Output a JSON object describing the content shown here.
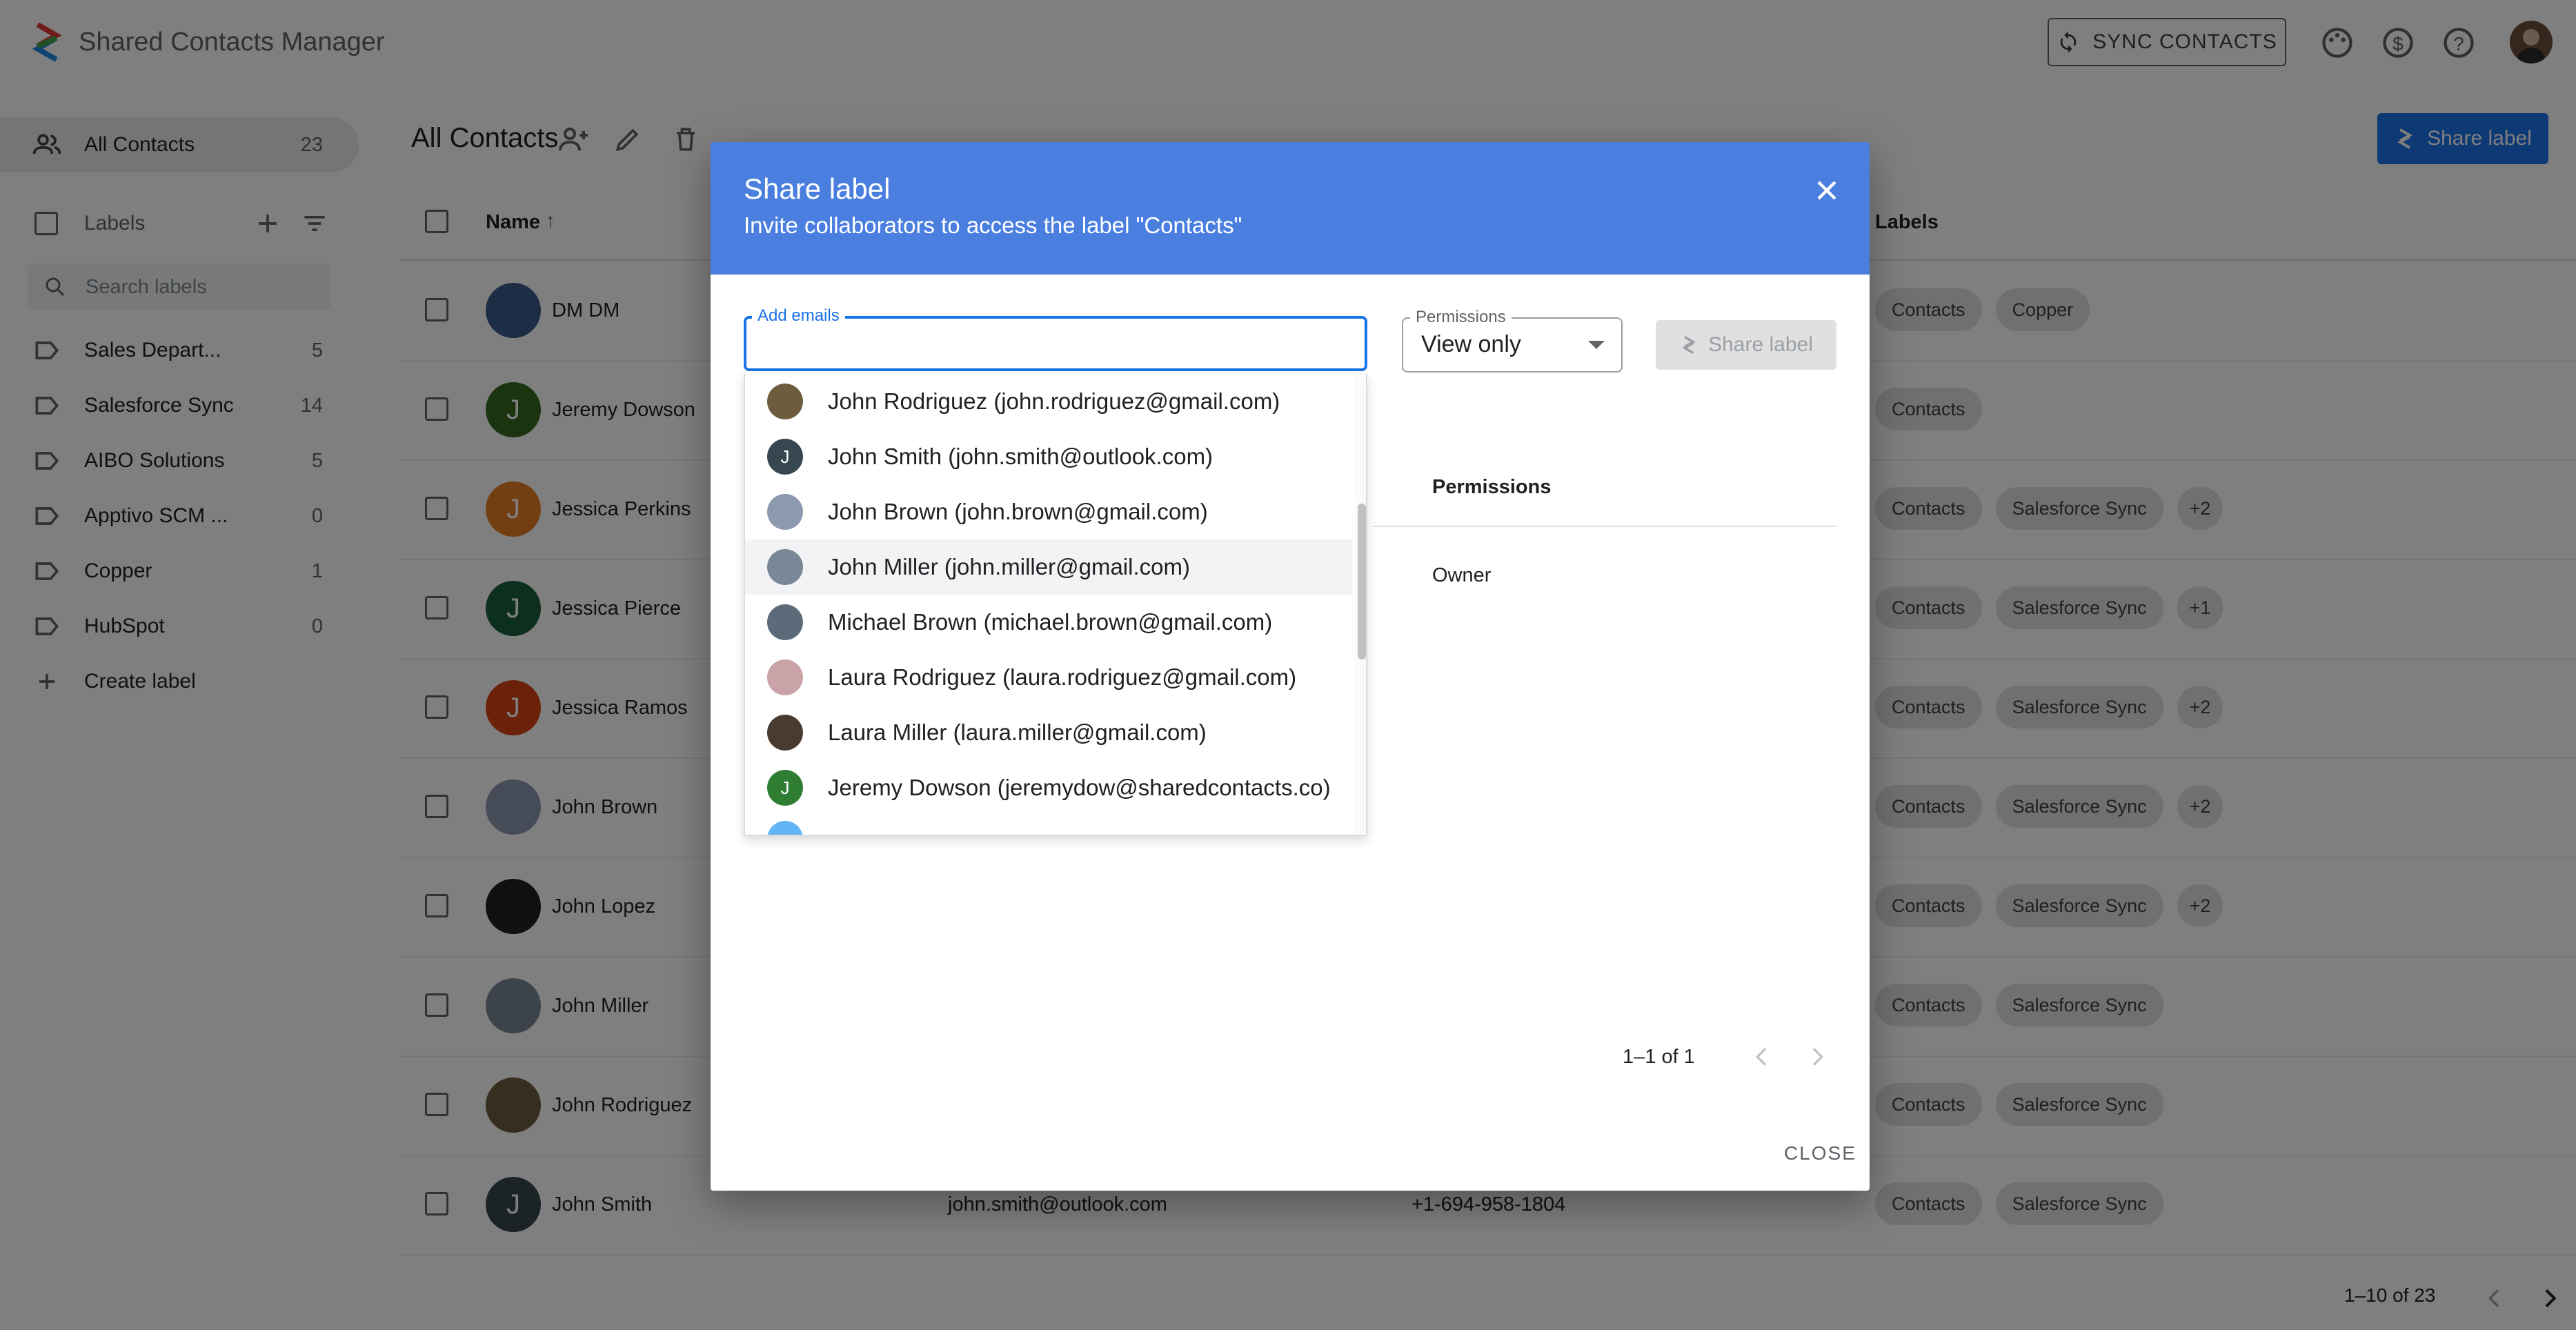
{
  "app": {
    "title": "Shared Contacts Manager",
    "sync_label": "SYNC CONTACTS"
  },
  "sidebar": {
    "all_contacts": {
      "label": "All Contacts",
      "count": "23"
    },
    "labels_heading": "Labels",
    "search_placeholder": "Search labels",
    "labels": [
      {
        "label": "Sales Depart...",
        "count": "5"
      },
      {
        "label": "Salesforce Sync",
        "count": "14"
      },
      {
        "label": "AIBO Solutions",
        "count": "5"
      },
      {
        "label": "Apptivo SCM ...",
        "count": "0"
      },
      {
        "label": "Copper",
        "count": "1"
      },
      {
        "label": "HubSpot",
        "count": "0"
      }
    ],
    "create_label": "Create label"
  },
  "main": {
    "title": "All Contacts",
    "share_label": "Share label",
    "columns": {
      "name": "Name",
      "labels": "Labels"
    },
    "rows": [
      {
        "name": "DM DM",
        "initial": "",
        "color": "#3b5b8a",
        "email": "",
        "phone": "",
        "labels": [
          "Contacts",
          "Copper"
        ],
        "more": ""
      },
      {
        "name": "Jeremy Dowson",
        "initial": "J",
        "color": "#33691e",
        "email": "",
        "phone": "",
        "labels": [
          "Contacts"
        ],
        "more": ""
      },
      {
        "name": "Jessica Perkins",
        "initial": "J",
        "color": "#e67c22",
        "email": "",
        "phone": "",
        "labels": [
          "Contacts",
          "Salesforce Sync"
        ],
        "more": "+2"
      },
      {
        "name": "Jessica Pierce",
        "initial": "J",
        "color": "#1b5e3b",
        "email": "",
        "phone": "",
        "labels": [
          "Contacts",
          "Salesforce Sync"
        ],
        "more": "+1"
      },
      {
        "name": "Jessica Ramos",
        "initial": "J",
        "color": "#d84315",
        "email": "",
        "phone": "",
        "labels": [
          "Contacts",
          "Salesforce Sync"
        ],
        "more": "+2"
      },
      {
        "name": "John Brown",
        "initial": "",
        "color": "#8d99ae",
        "email": "",
        "phone": "",
        "labels": [
          "Contacts",
          "Salesforce Sync"
        ],
        "more": "+2"
      },
      {
        "name": "John Lopez",
        "initial": "",
        "color": "#202020",
        "email": "",
        "phone": "",
        "labels": [
          "Contacts",
          "Salesforce Sync"
        ],
        "more": "+2"
      },
      {
        "name": "John Miller",
        "initial": "",
        "color": "#7a8797",
        "email": "",
        "phone": "",
        "labels": [
          "Contacts",
          "Salesforce Sync"
        ],
        "more": ""
      },
      {
        "name": "John Rodriguez",
        "initial": "",
        "color": "#6d5c3d",
        "email": "",
        "phone": "",
        "labels": [
          "Contacts",
          "Salesforce Sync"
        ],
        "more": ""
      },
      {
        "name": "John Smith",
        "initial": "J",
        "color": "#37474f",
        "email": "john.smith@outlook.com",
        "phone": "+1-694-958-1804",
        "labels": [
          "Contacts",
          "Salesforce Sync"
        ],
        "more": ""
      }
    ],
    "pager": "1–10 of 23"
  },
  "dialog": {
    "title": "Share label",
    "subtitle": "Invite collaborators to access the label \"Contacts\"",
    "email_label": "Add emails",
    "email_value": "",
    "permissions_label": "Permissions",
    "permissions_value": "View only",
    "share_button": "Share label",
    "permissions_column": "Permissions",
    "owner_value": "Owner",
    "pager": "1–1 of 1",
    "close_button": "CLOSE",
    "suggestions": [
      {
        "text": "John Rodriguez (john.rodriguez@gmail.com)",
        "initial": "",
        "color": "#6d5c3d"
      },
      {
        "text": "John Smith (john.smith@outlook.com)",
        "initial": "J",
        "color": "#37474f"
      },
      {
        "text": "John Brown (john.brown@gmail.com)",
        "initial": "",
        "color": "#8d99ae"
      },
      {
        "text": "John Miller (john.miller@gmail.com)",
        "initial": "",
        "color": "#7a8797",
        "highlight": true
      },
      {
        "text": "Michael Brown (michael.brown@gmail.com)",
        "initial": "",
        "color": "#5c6b7a"
      },
      {
        "text": "Laura Rodriguez (laura.rodriguez@gmail.com)",
        "initial": "",
        "color": "#c9a3a8"
      },
      {
        "text": "Laura Miller (laura.miller@gmail.com)",
        "initial": "",
        "color": "#4a3b30"
      },
      {
        "text": "Jeremy Dowson (jeremydow@sharedcontacts.co)",
        "initial": "J",
        "color": "#2e7d32"
      }
    ]
  }
}
